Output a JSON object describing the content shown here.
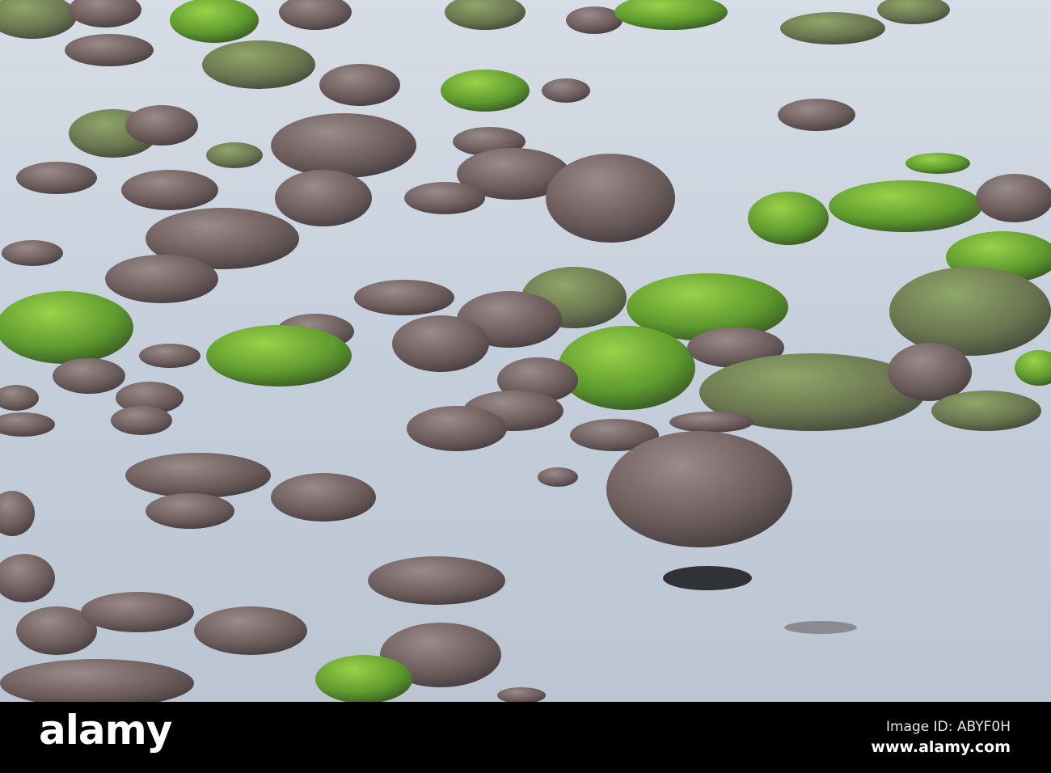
{
  "photo": {
    "subject": "rocks-in-water",
    "colors": {
      "water": "#c9d3df",
      "rock": "#6e5f5d",
      "moss": "#5e9a2e",
      "bar": "#000000"
    }
  },
  "watermark": {
    "logo": "alamy",
    "image_id": "Image ID: ABYF0H",
    "website": "www.alamy.com"
  }
}
